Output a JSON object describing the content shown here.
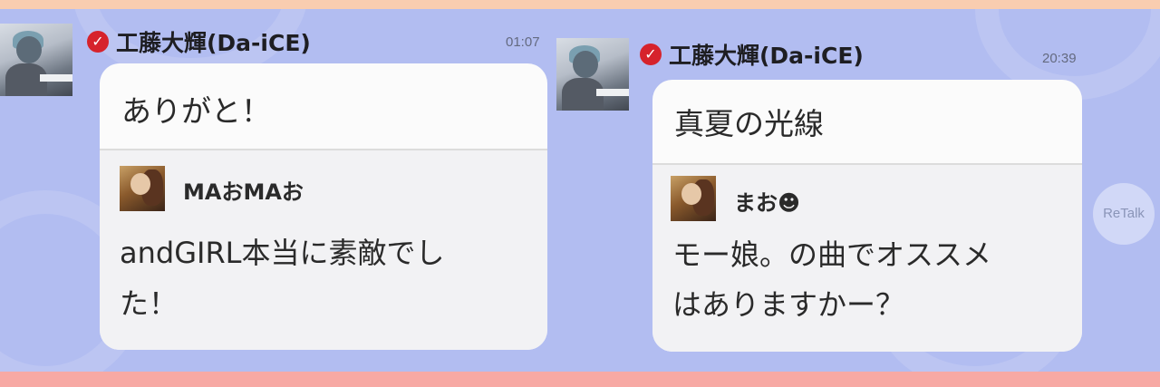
{
  "posts": [
    {
      "sender": "工藤大輝(Da-iCE)",
      "time": "01:07",
      "message": "ありがと！",
      "quote": {
        "user": "MAおMAお",
        "lines": [
          "andGIRL本当に素敵でし",
          "た！"
        ]
      }
    },
    {
      "sender": "工藤大輝(Da-iCE)",
      "time": "20:39",
      "message": "真夏の光線",
      "quote": {
        "user": "まお☻",
        "lines": [
          "モー娘。の曲でオススメ",
          "はありますかー？"
        ]
      }
    }
  ],
  "retalk_label": "ReTalk",
  "verified_glyph": "✓",
  "icons": {
    "verified": "verified-check-icon",
    "sender_avatar": "sender-avatar",
    "quote_avatar": "quoted-user-avatar"
  },
  "colors": {
    "panel_bg": "#b2bdf1",
    "top_strip": "#f9cdb0",
    "bottom_strip": "#f7a9a4",
    "verified_badge": "#d6232c",
    "bubble": "#fbfbfb"
  }
}
